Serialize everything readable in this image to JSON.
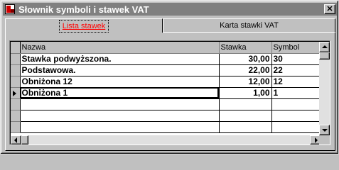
{
  "window": {
    "title": "Słownik symboli i stawek VAT",
    "close_label": "✕"
  },
  "tabs": [
    {
      "label": "Lista stawek",
      "active": true
    },
    {
      "label": "Karta stawki VAT",
      "active": false
    }
  ],
  "grid": {
    "columns": [
      "Nazwa",
      "Stawka",
      "Symbol"
    ],
    "rows": [
      {
        "nazwa": "Stawka podwyższona.",
        "stawka": "30,00",
        "symbol": "30"
      },
      {
        "nazwa": "Podstawowa.",
        "stawka": "22,00",
        "symbol": "22"
      },
      {
        "nazwa": "Obniżona 12",
        "stawka": "12,00",
        "symbol": "12"
      },
      {
        "nazwa": "Obniżona 1",
        "stawka": "1,00",
        "symbol": "1"
      }
    ],
    "current_row": 3
  },
  "icons": {
    "app": "app-icon",
    "close": "close-icon",
    "row_pointer": "row-pointer-icon"
  },
  "colors": {
    "active_tab_text": "#ff0000",
    "titlebar": "#808080",
    "face": "#c0c0c0"
  }
}
